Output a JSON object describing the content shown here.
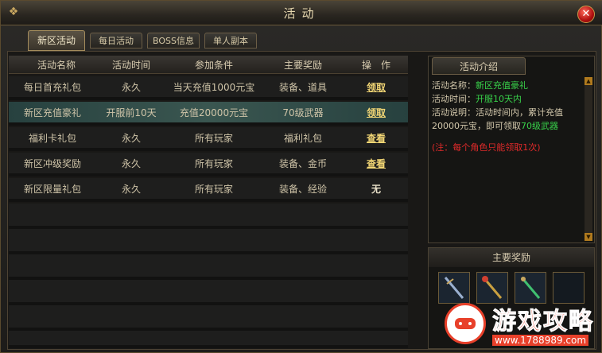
{
  "window": {
    "title": "活动",
    "close_symbol": "✕"
  },
  "tabs": [
    {
      "label": "新区活动",
      "active": true
    },
    {
      "label": "每日活动",
      "active": false
    },
    {
      "label": "BOSS信息",
      "active": false
    },
    {
      "label": "单人副本",
      "active": false
    }
  ],
  "table": {
    "headers": [
      "活动名称",
      "活动时间",
      "参加条件",
      "主要奖励",
      "操　作"
    ],
    "rows": [
      {
        "name": "每日首充礼包",
        "time": "永久",
        "condition": "当天充值1000元宝",
        "reward": "装备、道具",
        "action": "领取"
      },
      {
        "name": "新区充值豪礼",
        "time": "开服前10天",
        "condition": "充值20000元宝",
        "reward": "70级武器",
        "action": "领取",
        "selected": true
      },
      {
        "name": "福利卡礼包",
        "time": "永久",
        "condition": "所有玩家",
        "reward": "福利礼包",
        "action": "查看"
      },
      {
        "name": "新区冲级奖励",
        "time": "永久",
        "condition": "所有玩家",
        "reward": "装备、金币",
        "action": "查看"
      },
      {
        "name": "新区限量礼包",
        "time": "永久",
        "condition": "所有玩家",
        "reward": "装备、经验",
        "action": "无"
      }
    ]
  },
  "intro": {
    "tab_label": "活动介绍",
    "name_label": "活动名称：",
    "name_value": "新区充值豪礼",
    "time_label": "活动时间：",
    "time_value": "开服10天内",
    "desc_label": "活动说明：",
    "desc_text": "活动时间内，累计充值20000元宝，即可领取",
    "desc_value": "70级武器",
    "note": "(注：每个角色只能领取1次)"
  },
  "rewards": {
    "title": "主要奖励",
    "items": [
      "weapon-icon-1",
      "weapon-icon-2",
      "weapon-icon-3",
      "empty-slot"
    ]
  },
  "watermark": {
    "brand": "游戏攻略",
    "url": "www.1788989.com"
  },
  "colors": {
    "accent": "#c9a760",
    "highlight": "#38d24a",
    "note": "#e02a2a",
    "action": "#f2d675"
  }
}
